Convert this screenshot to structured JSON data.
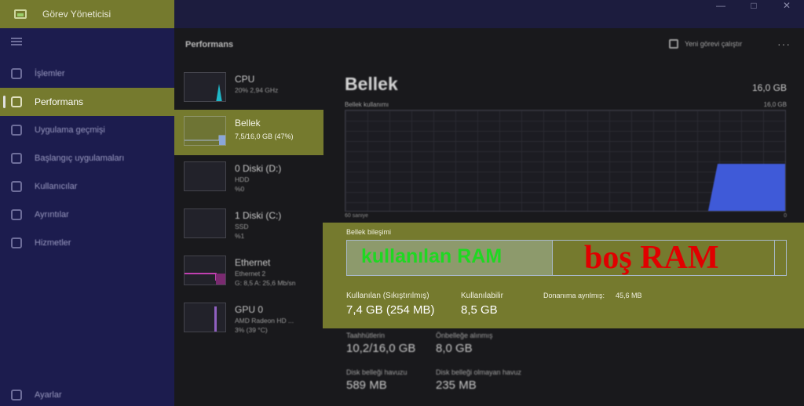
{
  "app": {
    "title": "Görev Yöneticisi"
  },
  "window_controls": [
    "—",
    "□",
    "✕"
  ],
  "sidebar": {
    "items": [
      {
        "label": "İşlemler",
        "icon": "processes-icon"
      },
      {
        "label": "Performans",
        "icon": "performance-icon",
        "active": true
      },
      {
        "label": "Uygulama geçmişi",
        "icon": "app-history-icon"
      },
      {
        "label": "Başlangıç uygulamaları",
        "icon": "startup-apps-icon"
      },
      {
        "label": "Kullanıcılar",
        "icon": "users-icon"
      },
      {
        "label": "Ayrıntılar",
        "icon": "details-icon"
      },
      {
        "label": "Hizmetler",
        "icon": "services-icon"
      }
    ],
    "settings_label": "Ayarlar"
  },
  "header": {
    "section_title": "Performans",
    "run_task_label": "Yeni görevi çalıştır",
    "more_label": "···"
  },
  "resources": [
    {
      "name": "CPU",
      "sub1": "20% 2,94 GHz",
      "sub2": ""
    },
    {
      "name": "Bellek",
      "sub1": "7,5/16,0 GB (47%)",
      "sub2": ""
    },
    {
      "name": "0 Diski (D:)",
      "sub1": "HDD",
      "sub2": "%0"
    },
    {
      "name": "1 Diski (C:)",
      "sub1": "SSD",
      "sub2": "%1"
    },
    {
      "name": "Ethernet",
      "sub1": "Ethernet 2",
      "sub2": "G: 8,5 A: 25,6 Mb/sn"
    },
    {
      "name": "GPU 0",
      "sub1": "AMD Radeon HD ...",
      "sub2": "3% (39 °C)"
    }
  ],
  "memory": {
    "title": "Bellek",
    "total": "16,0 GB",
    "usage_label": "Bellek kullanımı",
    "usage_max": "16,0 GB",
    "graph_left": "60 saniye",
    "graph_right": "0",
    "usage_fraction": 0.47,
    "composition_label": "Bellek bileşimi",
    "used_annotation": "kullanılan RAM",
    "free_annotation": "boş RAM",
    "in_use_label": "Kullanılan (Sıkıştırılmış)",
    "in_use_value": "7,4 GB (254 MB)",
    "available_label": "Kullanılabilir",
    "available_value": "8,5 GB",
    "hw_reserved_label": "Donanıma ayrılmış:",
    "hw_reserved_value": "45,6 MB",
    "committed_label": "Taahhütlerin",
    "committed_value": "10,2/16,0 GB",
    "cached_label": "Önbelleğe alınmış",
    "cached_value": "8,0 GB",
    "paged_label": "Disk belleği havuzu",
    "paged_value": "589 MB",
    "nonpaged_label": "Disk belleği olmayan havuz",
    "nonpaged_value": "235 MB"
  },
  "colors": {
    "highlight": "#757a2e",
    "sidebar_bg": "#1c1c4e",
    "memory_graph": "#3f5ad8",
    "used_annotation": "#1fd822",
    "free_annotation": "#e00000"
  }
}
